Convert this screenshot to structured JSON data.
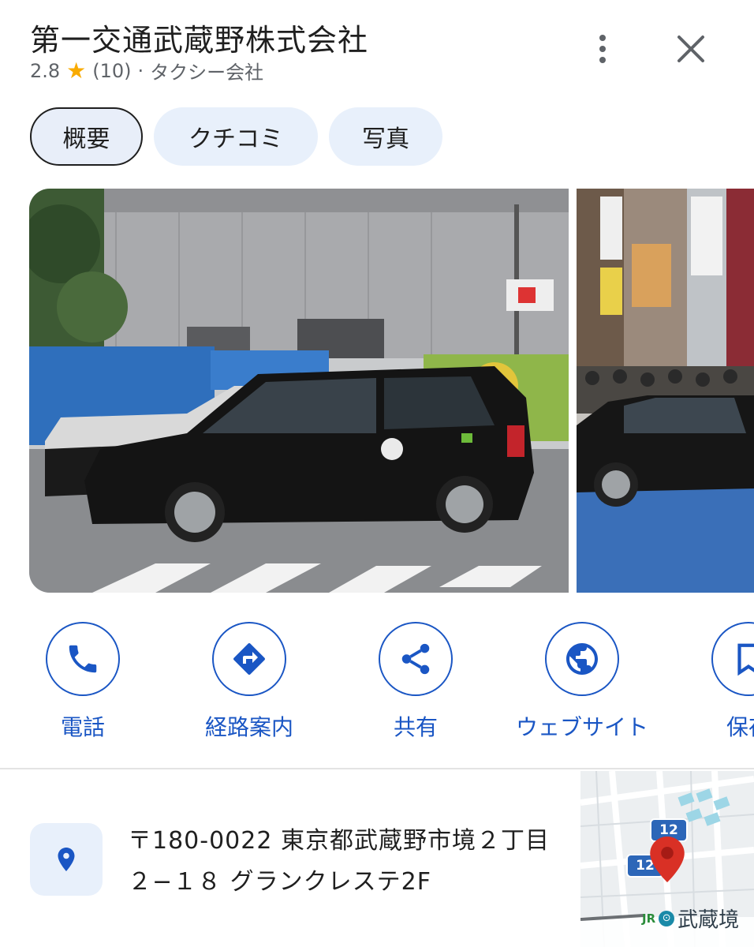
{
  "place": {
    "name": "第一交通武蔵野株式会社",
    "rating": "2.8",
    "review_count": "(10)",
    "separator": "·",
    "category": "タクシー会社"
  },
  "tabs": [
    {
      "label": "概要",
      "active": true
    },
    {
      "label": "クチコミ",
      "active": false
    },
    {
      "label": "写真",
      "active": false
    }
  ],
  "actions": [
    {
      "label": "電話",
      "icon": "phone-icon"
    },
    {
      "label": "経路案内",
      "icon": "directions-icon"
    },
    {
      "label": "共有",
      "icon": "share-icon"
    },
    {
      "label": "ウェブサイト",
      "icon": "globe-icon"
    },
    {
      "label": "保存",
      "icon": "bookmark-icon"
    }
  ],
  "address": {
    "line1": "〒180-0022 東京都武蔵野市境２丁目",
    "line2": "２−１８ グランクレステ2F"
  },
  "map": {
    "route_badge": "12",
    "route_badge_2": "12",
    "station_label": "武蔵境",
    "rail_logo": "JR"
  },
  "colors": {
    "accent": "#1a56c4",
    "star": "#f9ab00",
    "pin": "#d93025"
  }
}
